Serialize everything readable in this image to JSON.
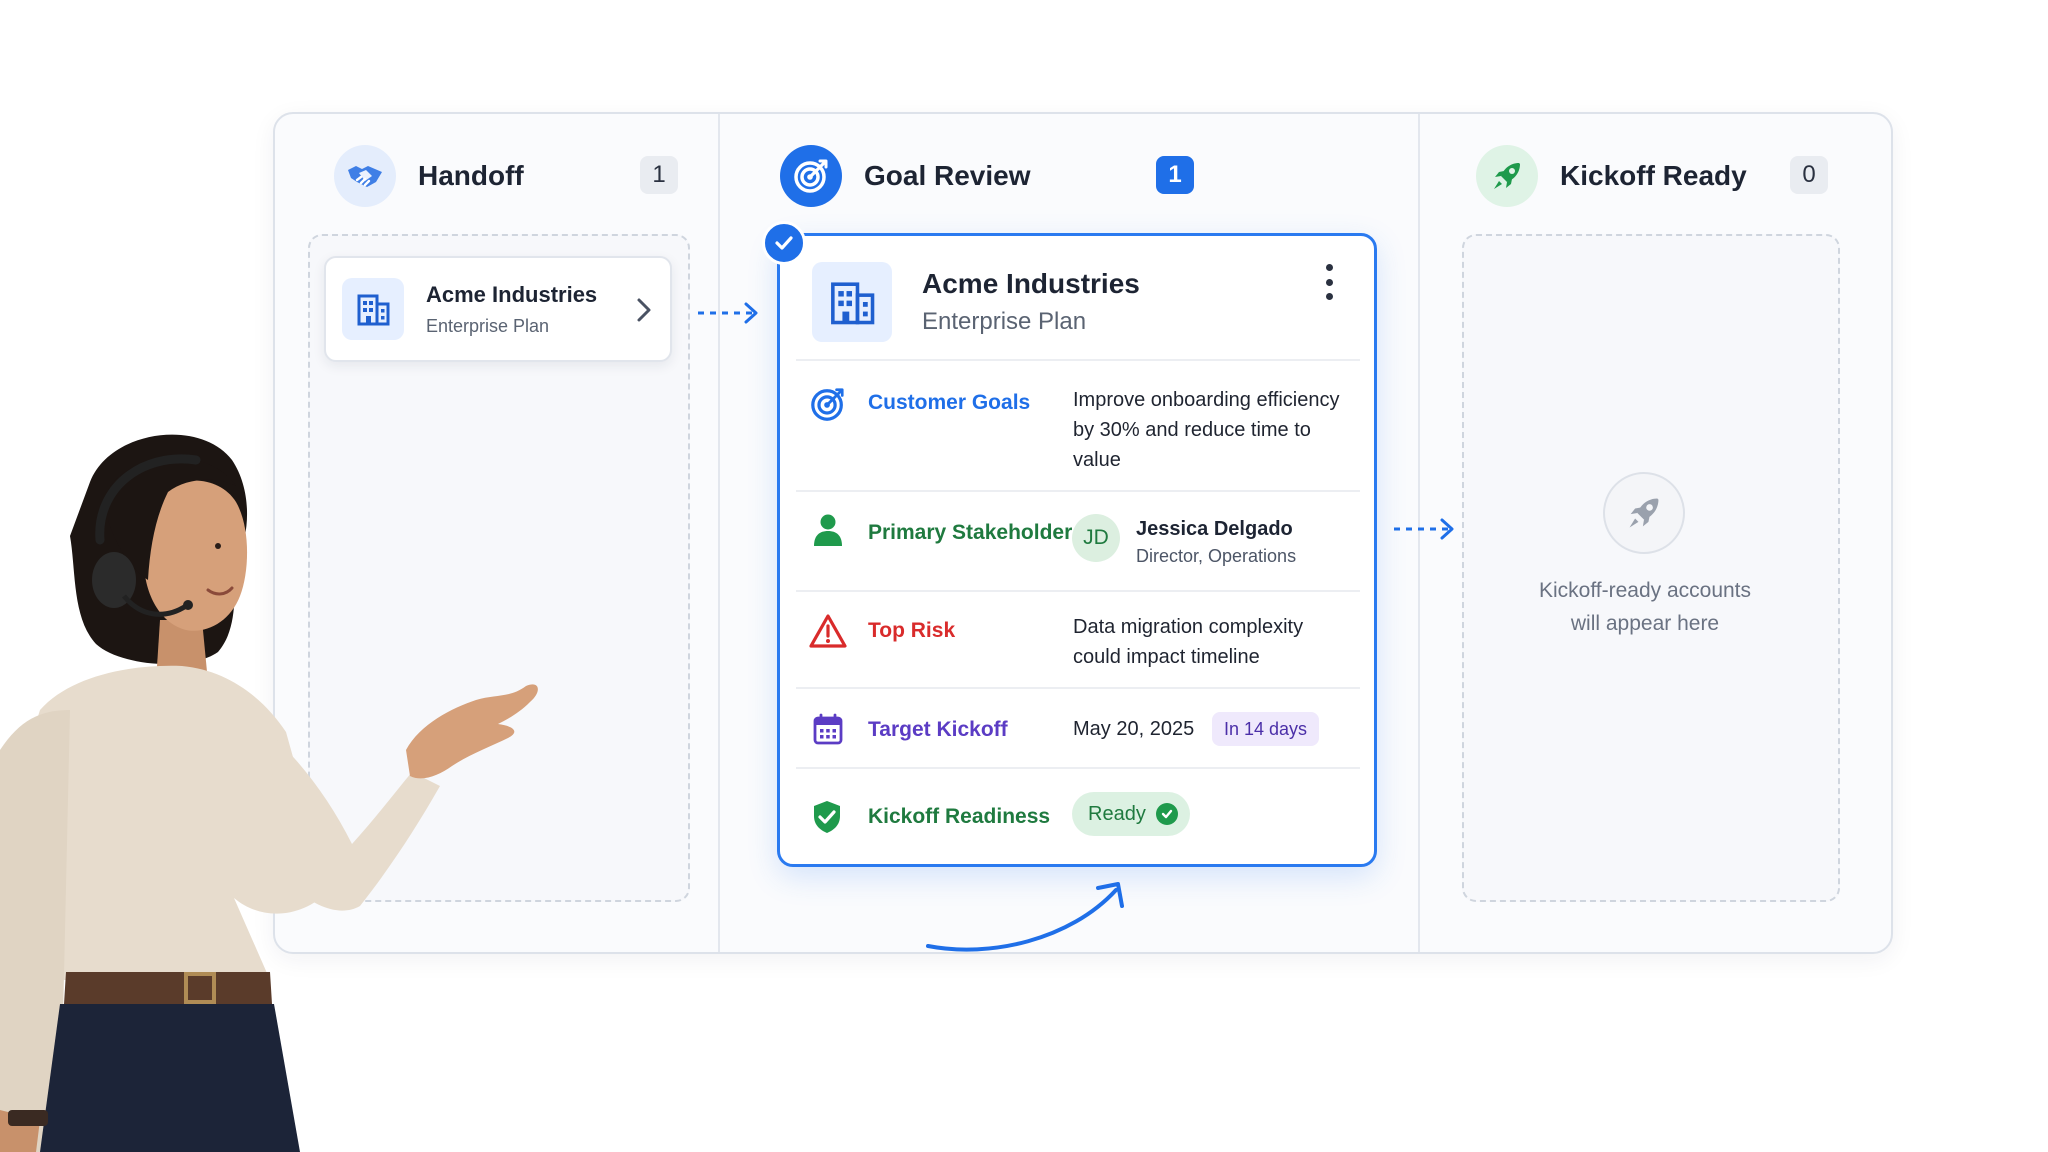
{
  "columns": [
    {
      "title": "Handoff",
      "count": "1"
    },
    {
      "title": "Goal Review",
      "count": "1"
    },
    {
      "title": "Kickoff Ready",
      "count": "0"
    }
  ],
  "handoff_card": {
    "name": "Acme Industries",
    "plan": "Enterprise Plan"
  },
  "review_card": {
    "name": "Acme Industries",
    "plan": "Enterprise Plan",
    "goals": {
      "label": "Customer Goals",
      "lines": [
        "Improve onboarding efficiency",
        "by 30% and reduce time to",
        "value"
      ]
    },
    "stakeholder": {
      "label": "Primary Stakeholder",
      "initials": "JD",
      "name": "Jessica Delgado",
      "title": "Director, Operations"
    },
    "risk": {
      "label": "Top Risk",
      "lines": [
        "Data migration complexity",
        "could impact timeline"
      ]
    },
    "kickoff": {
      "label": "Target Kickoff",
      "date": "May 20, 2025",
      "badge": "In 14 days"
    },
    "readiness": {
      "label": "Kickoff Readiness",
      "status": "Ready"
    }
  },
  "empty_state": {
    "lines": [
      "Kickoff-ready accounts",
      "will appear here"
    ]
  },
  "colors": {
    "accent": "#1f6fe8",
    "goals": "#1f6fe8",
    "stakeholder": "#1f7a3f",
    "risk": "#d92b2b",
    "kickoff": "#5b3cc4",
    "readiness": "#1f7a3f"
  },
  "icons": [
    "handshake-icon",
    "target-icon",
    "rocket-icon",
    "building-icon",
    "chevron-right-icon",
    "check-icon",
    "kebab-menu-icon",
    "person-icon",
    "warning-icon",
    "calendar-icon",
    "shield-check-icon"
  ]
}
